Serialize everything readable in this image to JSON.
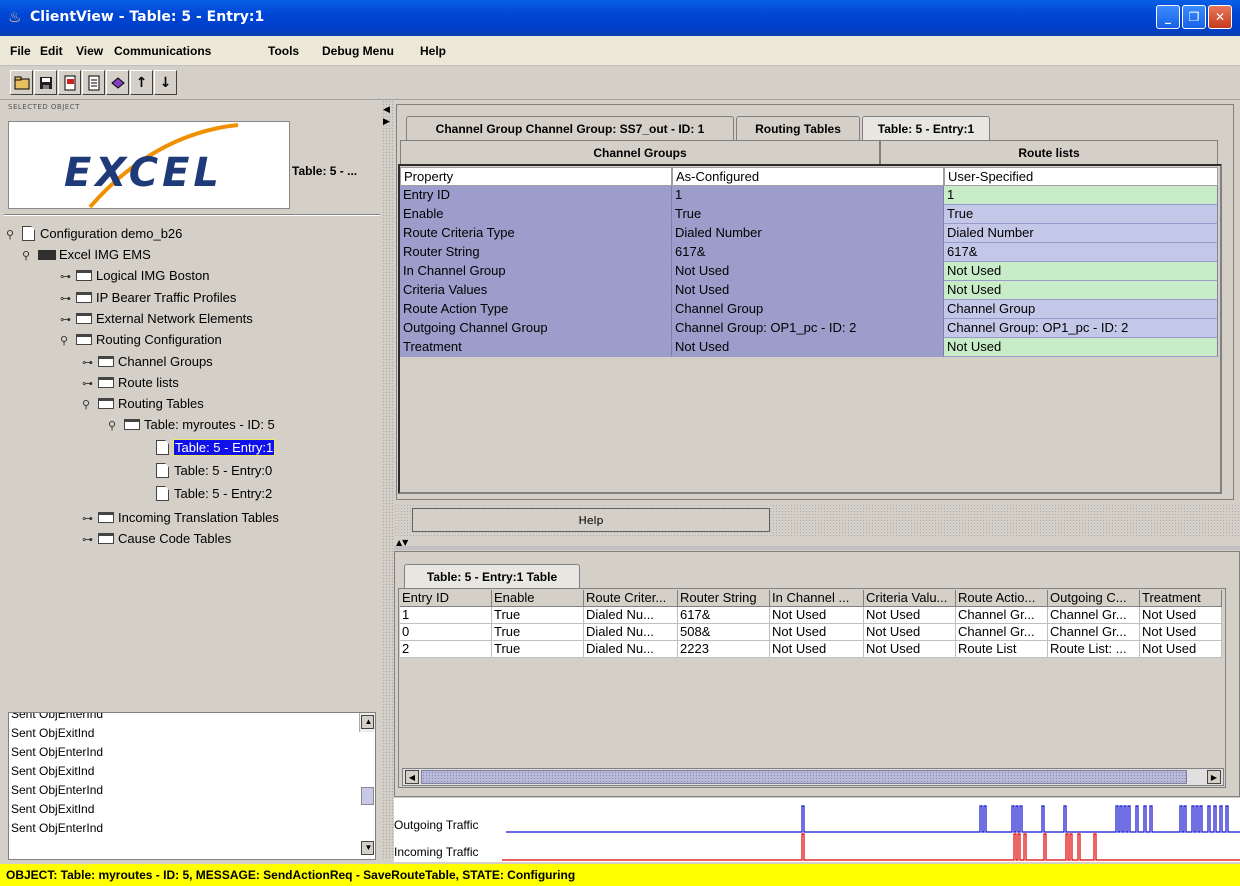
{
  "window": {
    "title": "ClientView - Table: 5 - Entry:1",
    "min_label": "_",
    "max_label": "❐",
    "close_label": "✕"
  },
  "menu": [
    "File",
    "Edit",
    "View",
    "Communications",
    "Tools",
    "Debug Menu",
    "Help"
  ],
  "toolbar": {
    "buttons": [
      "open-icon",
      "save-icon",
      "import-icon",
      "export-icon",
      "book-icon",
      "arrow-up-icon",
      "arrow-down-icon"
    ],
    "up_glyph": "↑",
    "down_glyph": "↓"
  },
  "selected_object": {
    "label": "SELECTED OBJECT",
    "logo_text": "EXCEL",
    "name": "Table: 5 - ..."
  },
  "tree": [
    {
      "label": "Configuration demo_b26",
      "type": "doc-root",
      "expander": "⚲"
    },
    {
      "label": "Excel IMG EMS",
      "type": "device",
      "expander": "⚲"
    },
    {
      "label": "Logical IMG Boston",
      "type": "folder",
      "expander": "⊶"
    },
    {
      "label": "IP Bearer Traffic Profiles",
      "type": "folder",
      "expander": "⊶"
    },
    {
      "label": "External Network Elements",
      "type": "folder",
      "expander": "⊶"
    },
    {
      "label": "Routing Configuration",
      "type": "folder",
      "expander": "⚲"
    },
    {
      "label": "Channel Groups",
      "type": "folder",
      "expander": "⊶"
    },
    {
      "label": "Route lists",
      "type": "folder",
      "expander": "⊶"
    },
    {
      "label": "Routing Tables",
      "type": "folder",
      "expander": "⚲"
    },
    {
      "label": "Table: myroutes - ID: 5",
      "type": "folder",
      "expander": "⚲"
    },
    {
      "label": "Table: 5 - Entry:1",
      "type": "doc",
      "expander": "",
      "selected": true
    },
    {
      "label": "Table: 5 - Entry:0",
      "type": "doc",
      "expander": ""
    },
    {
      "label": "Table: 5 - Entry:2",
      "type": "doc",
      "expander": ""
    },
    {
      "label": "Incoming Translation Tables",
      "type": "folder",
      "expander": "⊶"
    },
    {
      "label": "Cause Code Tables",
      "type": "folder",
      "expander": "⊶"
    }
  ],
  "log": [
    "Sent ObjEnterInd",
    "Sent ObjExitInd",
    "Sent ObjEnterInd",
    "Sent ObjExitInd",
    "Sent ObjEnterInd",
    "Sent ObjExitInd",
    "Sent ObjEnterInd"
  ],
  "tabs_top": [
    "Channel Group Channel Group: SS7_out - ID: 1",
    "Routing Tables",
    "Table: 5 - Entry:1"
  ],
  "tabs_second": [
    "Channel Groups",
    "Route lists"
  ],
  "property_table": {
    "headers": [
      "Property",
      "As-Configured",
      "User-Specified"
    ],
    "rows": [
      [
        "Entry ID",
        "1",
        "1"
      ],
      [
        "Enable",
        "True",
        "True"
      ],
      [
        "Route Criteria Type",
        "Dialed Number",
        "Dialed Number"
      ],
      [
        "Router String",
        "617&",
        "617&"
      ],
      [
        "In Channel Group",
        "Not Used",
        "Not Used"
      ],
      [
        "Criteria Values",
        "Not Used",
        "Not Used"
      ],
      [
        "Route Action Type",
        "Channel Group",
        "Channel Group"
      ],
      [
        "Outgoing Channel Group",
        "Channel Group: OP1_pc - ID: 2",
        "Channel Group: OP1_pc - ID: 2"
      ],
      [
        "Treatment",
        "Not Used",
        "Not Used"
      ]
    ],
    "user_cell_colors": [
      "#c8ecc8",
      "#c4c8e8",
      "#c4c8e8",
      "#c4c8e8",
      "#c8ecc8",
      "#c8ecc8",
      "#c4c8e8",
      "#c4c8e8",
      "#c8ecc8"
    ]
  },
  "help_button": "Help",
  "bottom_tab": "Table: 5 - Entry:1 Table",
  "bottom_table": {
    "headers": [
      "Entry ID",
      "Enable",
      "Route Criter...",
      "Router String",
      "In Channel ...",
      "Criteria Valu...",
      "Route Actio...",
      "Outgoing C...",
      "Treatment"
    ],
    "rows": [
      [
        "1",
        "True",
        "Dialed Nu...",
        "617&",
        "Not Used",
        "Not Used",
        "Channel Gr...",
        "Channel Gr...",
        "Not Used"
      ],
      [
        "0",
        "True",
        "Dialed Nu...",
        "508&",
        "Not Used",
        "Not Used",
        "Channel Gr...",
        "Channel Gr...",
        "Not Used"
      ],
      [
        "2",
        "True",
        "Dialed Nu...",
        "2223",
        "Not Used",
        "Not Used",
        "Route List",
        "Route List: ...",
        "Not Used"
      ]
    ]
  },
  "traffic": {
    "outgoing_label": "Outgoing Traffic",
    "incoming_label": "Incoming Traffic",
    "outgoing_color": "#1010d0",
    "incoming_color": "#e00000"
  },
  "status": "OBJECT: Table: myroutes - ID: 5,  MESSAGE: SendActionReq - SaveRouteTable,  STATE: Configuring"
}
